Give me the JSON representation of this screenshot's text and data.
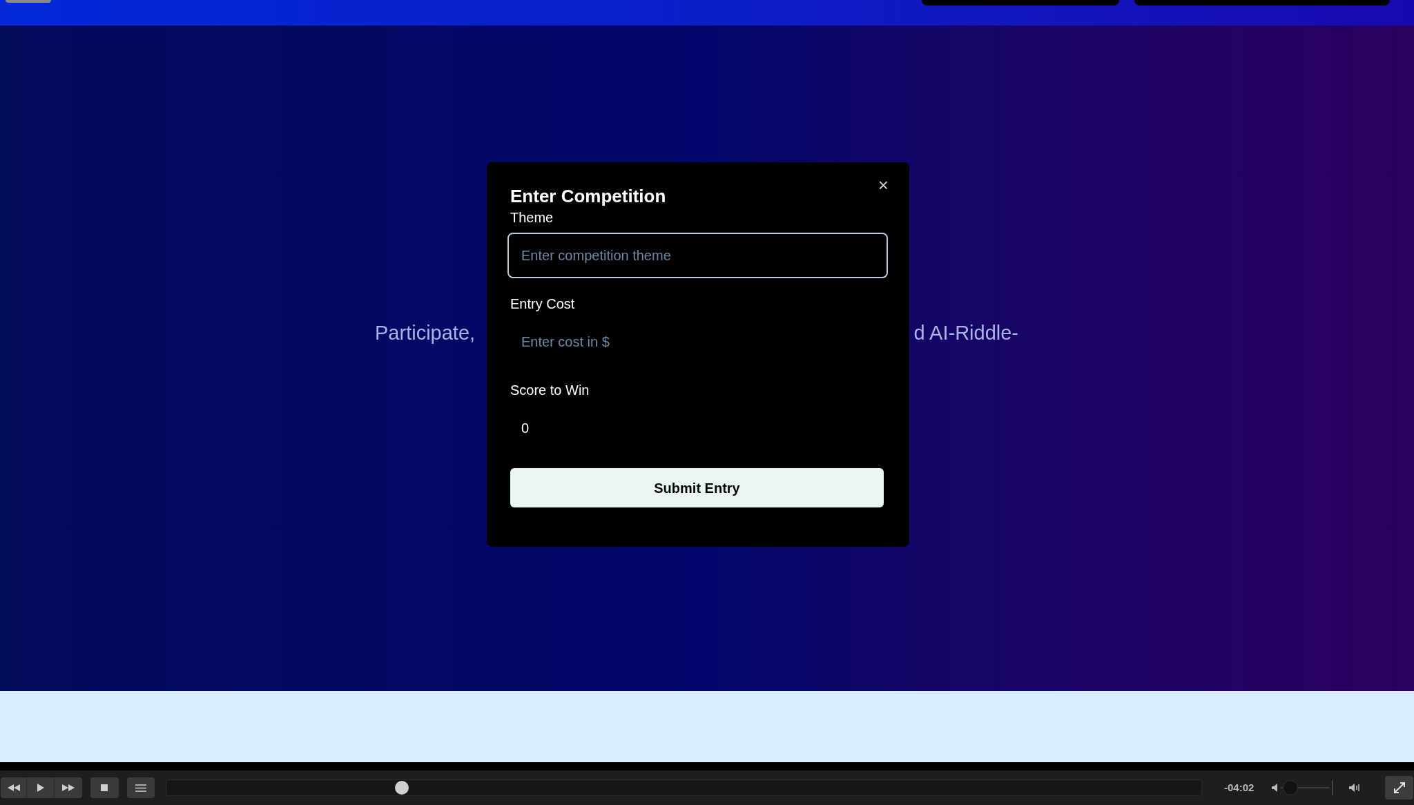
{
  "hero": {
    "subtitle_left": "Participate,",
    "subtitle_right": "d AI-Riddle-"
  },
  "dialog": {
    "title": "Enter Competition",
    "close_icon": "×",
    "fields": [
      {
        "label": "Theme",
        "placeholder": "Enter competition theme",
        "focused": true
      },
      {
        "label": "Entry Cost",
        "placeholder": "Enter cost in $",
        "focused": false
      },
      {
        "label": "Score to Win",
        "value": "0",
        "focused": false
      }
    ],
    "submit": "Submit Entry"
  },
  "player": {
    "progress": {
      "level": 0.227
    },
    "time": "-04:02",
    "volume": {
      "level": 0.2
    }
  }
}
